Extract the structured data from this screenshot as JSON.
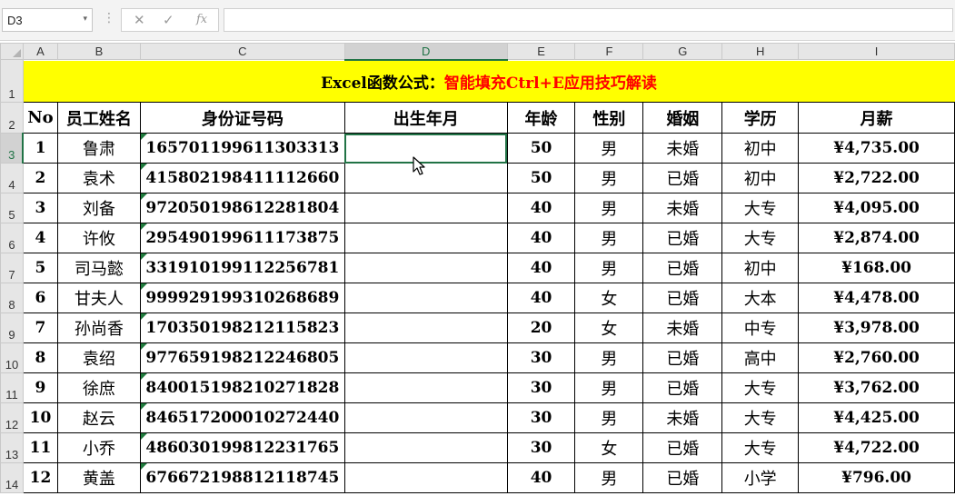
{
  "formula_bar": {
    "name_box": "D3",
    "name_box_arrow": "▾",
    "more": "⋮",
    "cancel": "✕",
    "enter": "✓",
    "fx": "fx",
    "formula": ""
  },
  "columns": [
    "A",
    "B",
    "C",
    "D",
    "E",
    "F",
    "G",
    "H",
    "I"
  ],
  "rows": [
    "1",
    "2",
    "3",
    "4",
    "5",
    "6",
    "7",
    "8",
    "9",
    "10",
    "11",
    "12",
    "13",
    "14"
  ],
  "title": {
    "black_part": "Excel函数公式：",
    "red_part": "智能填充Ctrl+E应用技巧解读"
  },
  "headers": [
    "No",
    "员工姓名",
    "身份证号码",
    "出生年月",
    "年龄",
    "性别",
    "婚姻",
    "学历",
    "月薪"
  ],
  "employees": [
    {
      "no": "1",
      "name": "鲁肃",
      "id": "165701199611303313",
      "birth": "",
      "age": "50",
      "gender": "男",
      "marriage": "未婚",
      "edu": "初中",
      "salary": "¥4,735.00"
    },
    {
      "no": "2",
      "name": "袁术",
      "id": "415802198411112660",
      "birth": "",
      "age": "50",
      "gender": "男",
      "marriage": "已婚",
      "edu": "初中",
      "salary": "¥2,722.00"
    },
    {
      "no": "3",
      "name": "刘备",
      "id": "972050198612281804",
      "birth": "",
      "age": "40",
      "gender": "男",
      "marriage": "未婚",
      "edu": "大专",
      "salary": "¥4,095.00"
    },
    {
      "no": "4",
      "name": "许攸",
      "id": "295490199611173875",
      "birth": "",
      "age": "40",
      "gender": "男",
      "marriage": "已婚",
      "edu": "大专",
      "salary": "¥2,874.00"
    },
    {
      "no": "5",
      "name": "司马懿",
      "id": "331910199112256781",
      "birth": "",
      "age": "40",
      "gender": "男",
      "marriage": "已婚",
      "edu": "初中",
      "salary": "¥168.00"
    },
    {
      "no": "6",
      "name": "甘夫人",
      "id": "999929199310268689",
      "birth": "",
      "age": "40",
      "gender": "女",
      "marriage": "已婚",
      "edu": "大本",
      "salary": "¥4,478.00"
    },
    {
      "no": "7",
      "name": "孙尚香",
      "id": "170350198212115823",
      "birth": "",
      "age": "20",
      "gender": "女",
      "marriage": "未婚",
      "edu": "中专",
      "salary": "¥3,978.00"
    },
    {
      "no": "8",
      "name": "袁绍",
      "id": "977659198212246805",
      "birth": "",
      "age": "30",
      "gender": "男",
      "marriage": "已婚",
      "edu": "高中",
      "salary": "¥2,760.00"
    },
    {
      "no": "9",
      "name": "徐庶",
      "id": "840015198210271828",
      "birth": "",
      "age": "30",
      "gender": "男",
      "marriage": "已婚",
      "edu": "大专",
      "salary": "¥3,762.00"
    },
    {
      "no": "10",
      "name": "赵云",
      "id": "846517200010272440",
      "birth": "",
      "age": "30",
      "gender": "男",
      "marriage": "未婚",
      "edu": "大专",
      "salary": "¥4,425.00"
    },
    {
      "no": "11",
      "name": "小乔",
      "id": "486030199812231765",
      "birth": "",
      "age": "30",
      "gender": "女",
      "marriage": "已婚",
      "edu": "大专",
      "salary": "¥4,722.00"
    },
    {
      "no": "12",
      "name": "黄盖",
      "id": "676672198812118745",
      "birth": "",
      "age": "40",
      "gender": "男",
      "marriage": "已婚",
      "edu": "小学",
      "salary": "¥796.00"
    }
  ],
  "colors": {
    "title_bg": "#ffff00",
    "title_highlight": "#ff0000",
    "selection": "#217346",
    "error_indicator": "#1e7a3c"
  },
  "icons": {
    "cursor": "mouse-pointer-icon",
    "error": "error-indicator-icon"
  }
}
